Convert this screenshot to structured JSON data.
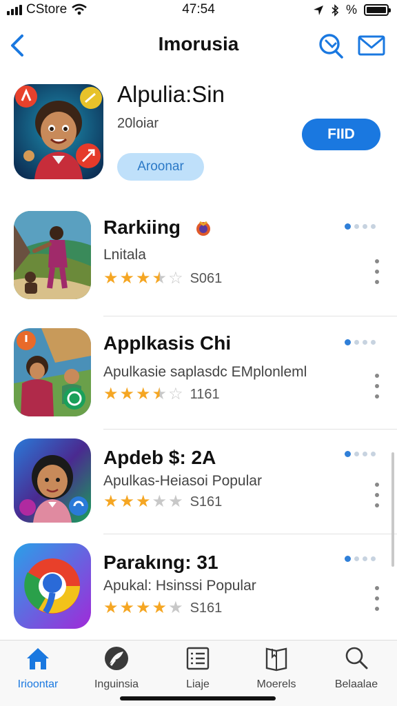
{
  "status": {
    "carrier": "CStore",
    "time": "47:54",
    "battery_label": "%"
  },
  "navbar": {
    "title": "Imorusia"
  },
  "featured": {
    "name": "Alpulia:Sin",
    "subtitle": "20loiar",
    "tag": "Aroonar",
    "button": "FIID"
  },
  "apps": [
    {
      "name": "Rarkiing",
      "desc": "Lnitala",
      "rating": "3.5",
      "count": "S061"
    },
    {
      "name": "Applkasis Chi",
      "desc": "Apulkasie saplasdc EMplonleml",
      "rating": "3.5",
      "count": "1161"
    },
    {
      "name": "Apdeb $: 2A",
      "desc": "Apulkas-Heiasoi Popular",
      "rating": "3",
      "count": "S161"
    },
    {
      "name": "Parakıng: 31",
      "desc": "Apukal: Hsinssi Popular",
      "rating": "4",
      "count": "S161"
    }
  ],
  "tabs": [
    {
      "label": "Irioontar",
      "icon": "house-icon",
      "active": true
    },
    {
      "label": "Inguinsia",
      "icon": "compass-icon",
      "active": false
    },
    {
      "label": "Liaje",
      "icon": "list-icon",
      "active": false
    },
    {
      "label": "Moerels",
      "icon": "book-icon",
      "active": false
    },
    {
      "label": "Belaalae",
      "icon": "search-icon",
      "active": false
    }
  ],
  "colors": {
    "accent": "#1a78e0",
    "star": "#f5a623",
    "tag_bg": "#bfe0fa"
  }
}
